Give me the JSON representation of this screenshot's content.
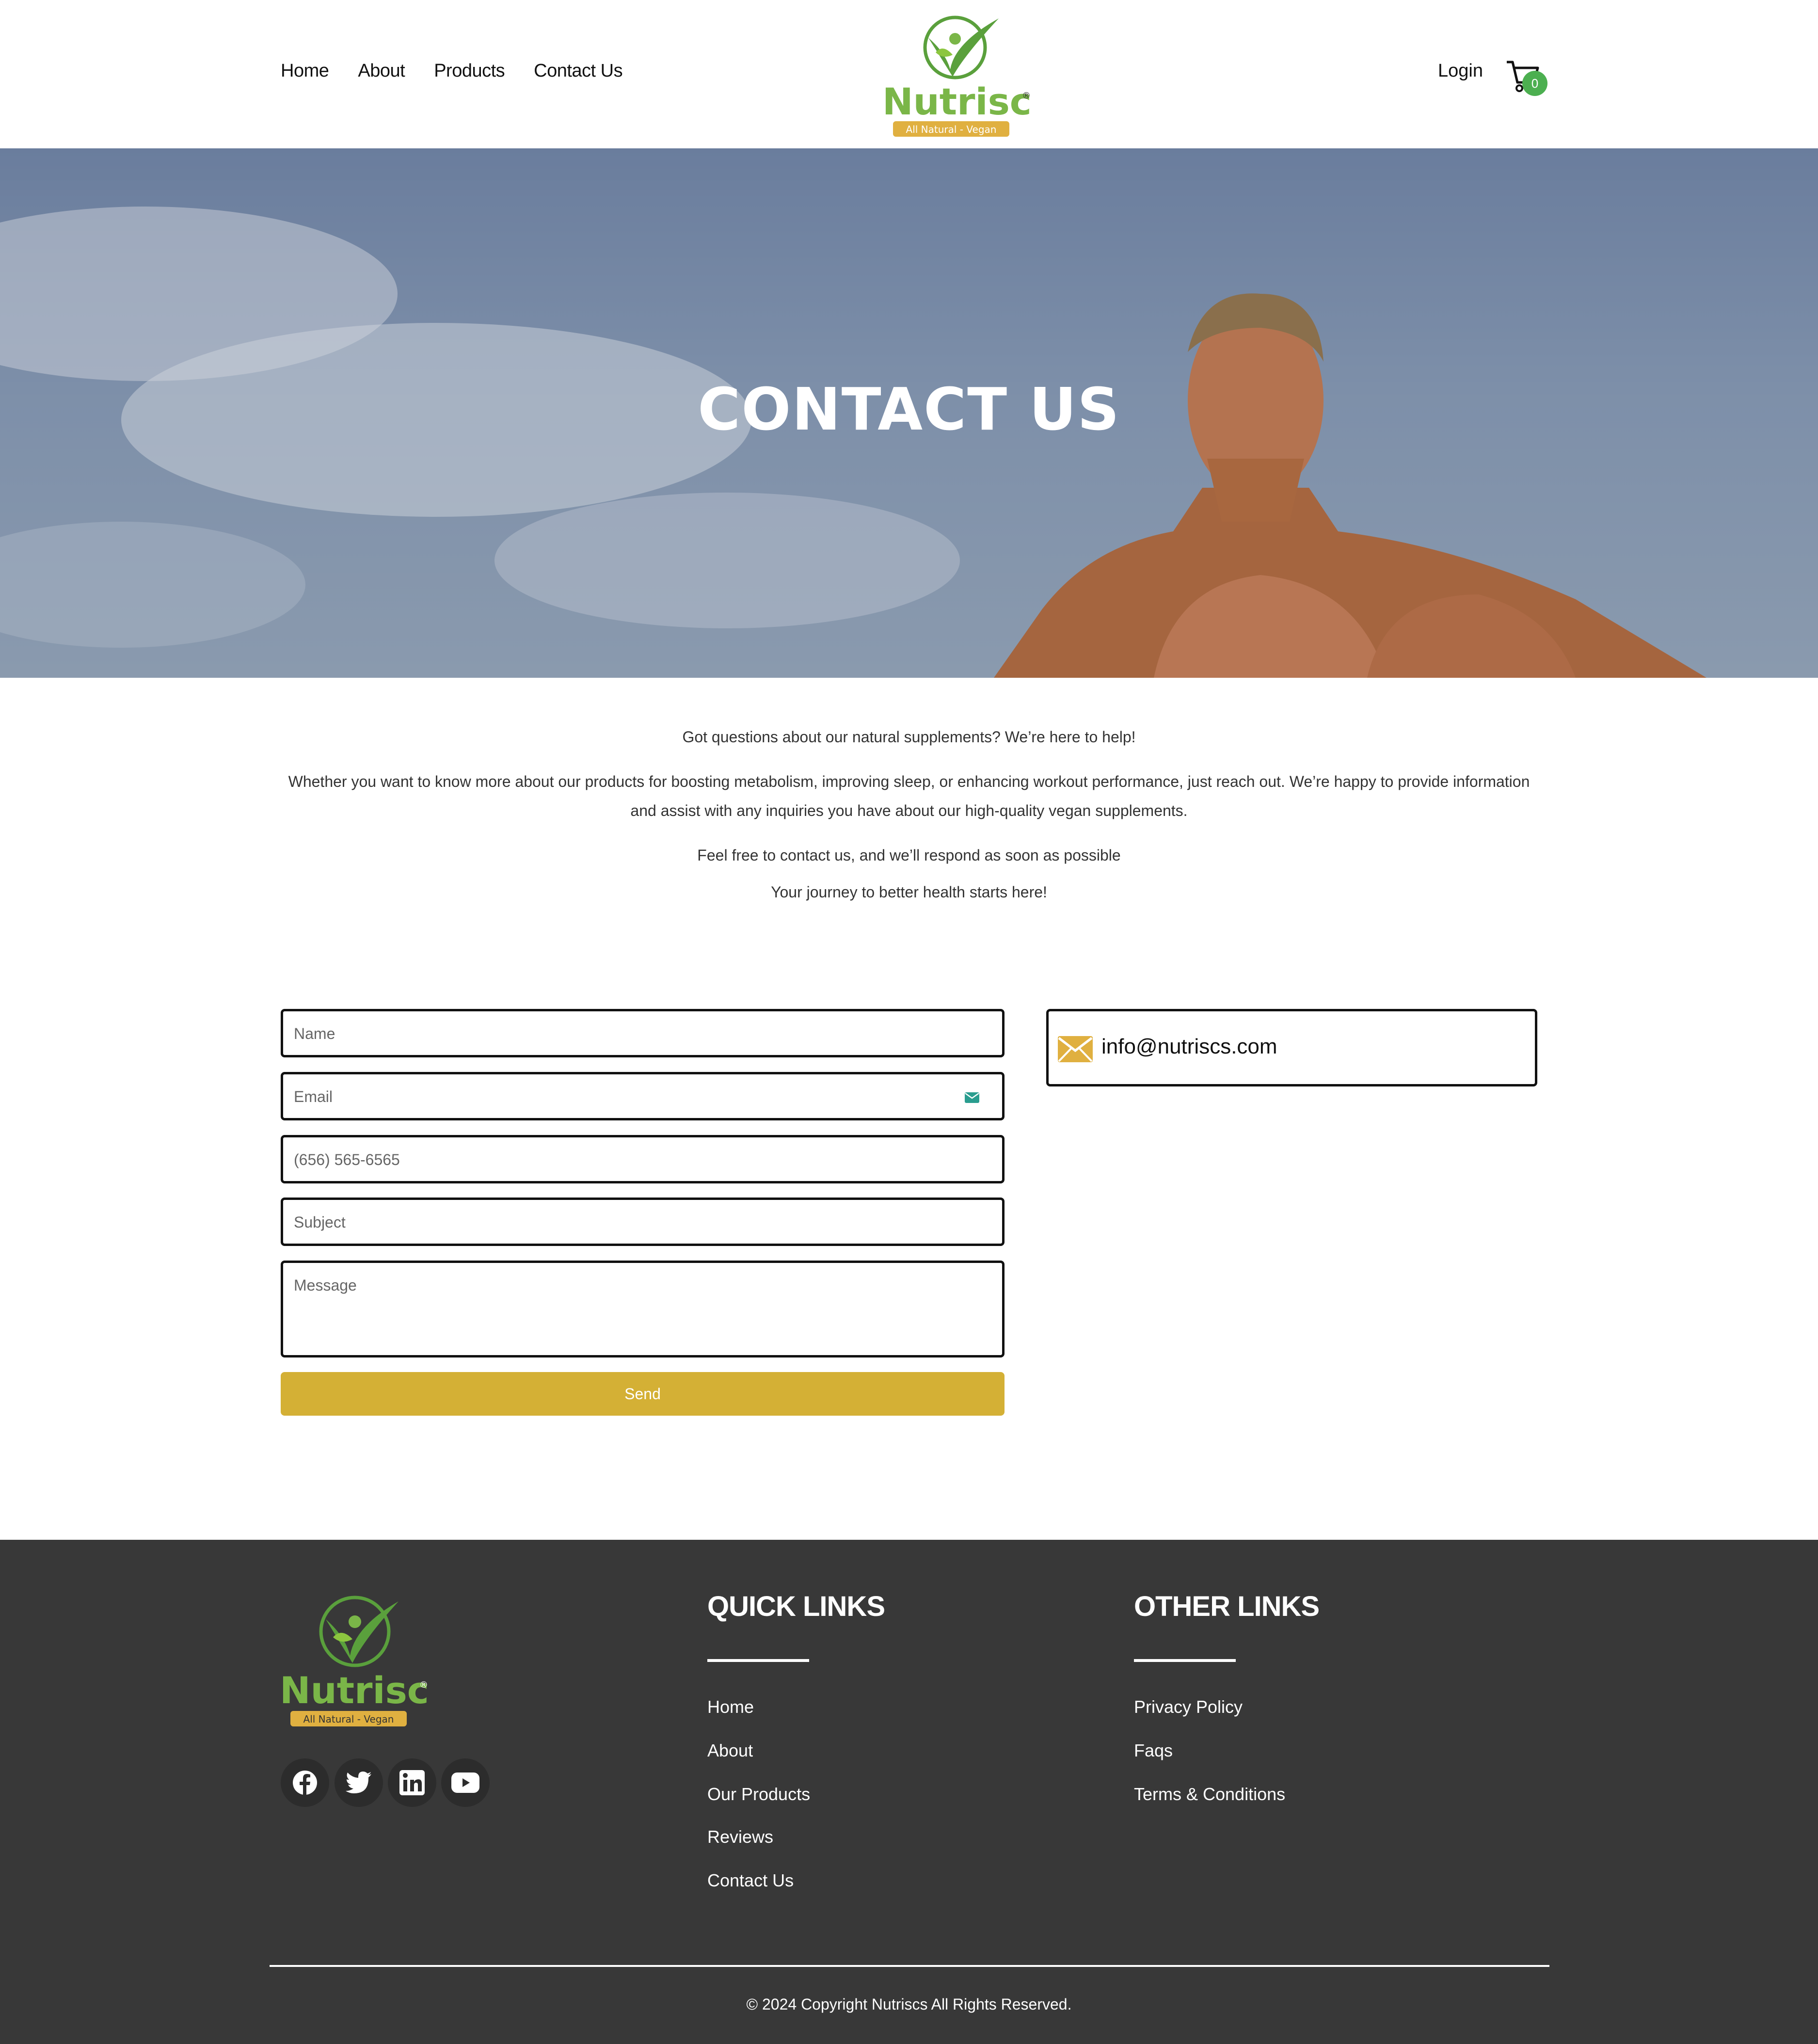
{
  "header": {
    "nav": [
      "Home",
      "About",
      "Products",
      "Contact Us"
    ],
    "brand": "Nutriscs",
    "tagline": "All Natural - Vegan",
    "login": "Login",
    "cart_count": "0"
  },
  "hero": {
    "title": "CONTACT US"
  },
  "intro": {
    "line1": "Got questions about our natural supplements? We’re here to help!",
    "line2": "Whether you want to know more about our products for boosting metabolism, improving sleep, or enhancing workout performance, just reach out. We’re happy to provide information and assist with any inquiries you have about our high-quality vegan supplements.",
    "line3": "Feel free to contact us, and we’ll respond as soon as possible",
    "line4": "Your journey to better health starts here!"
  },
  "form": {
    "name_placeholder": "Name",
    "email_placeholder": "Email",
    "phone_placeholder": "(656) 565-6565",
    "subject_placeholder": "Subject",
    "message_placeholder": "Message",
    "send_label": "Send"
  },
  "contact": {
    "email": "info@nutriscs.com"
  },
  "footer": {
    "quick_links_title": "QUICK LINKS",
    "quick_links": [
      "Home",
      "About",
      "Our Products",
      "Reviews",
      "Contact Us"
    ],
    "other_links_title": "OTHER LINKS",
    "other_links": [
      "Privacy Policy",
      "Faqs",
      "Terms & Conditions"
    ],
    "copyright": "© 2024 Copyright Nutriscs All Rights Reserved."
  },
  "colors": {
    "brand_green": "#7ab648",
    "accent_gold": "#d4b035",
    "footer_bg": "#383838",
    "badge_green": "#4caf50"
  },
  "icons": [
    "logo-leaf-icon",
    "cart-icon",
    "mail-icon",
    "facebook-icon",
    "twitter-icon",
    "linkedin-icon",
    "youtube-icon"
  ]
}
